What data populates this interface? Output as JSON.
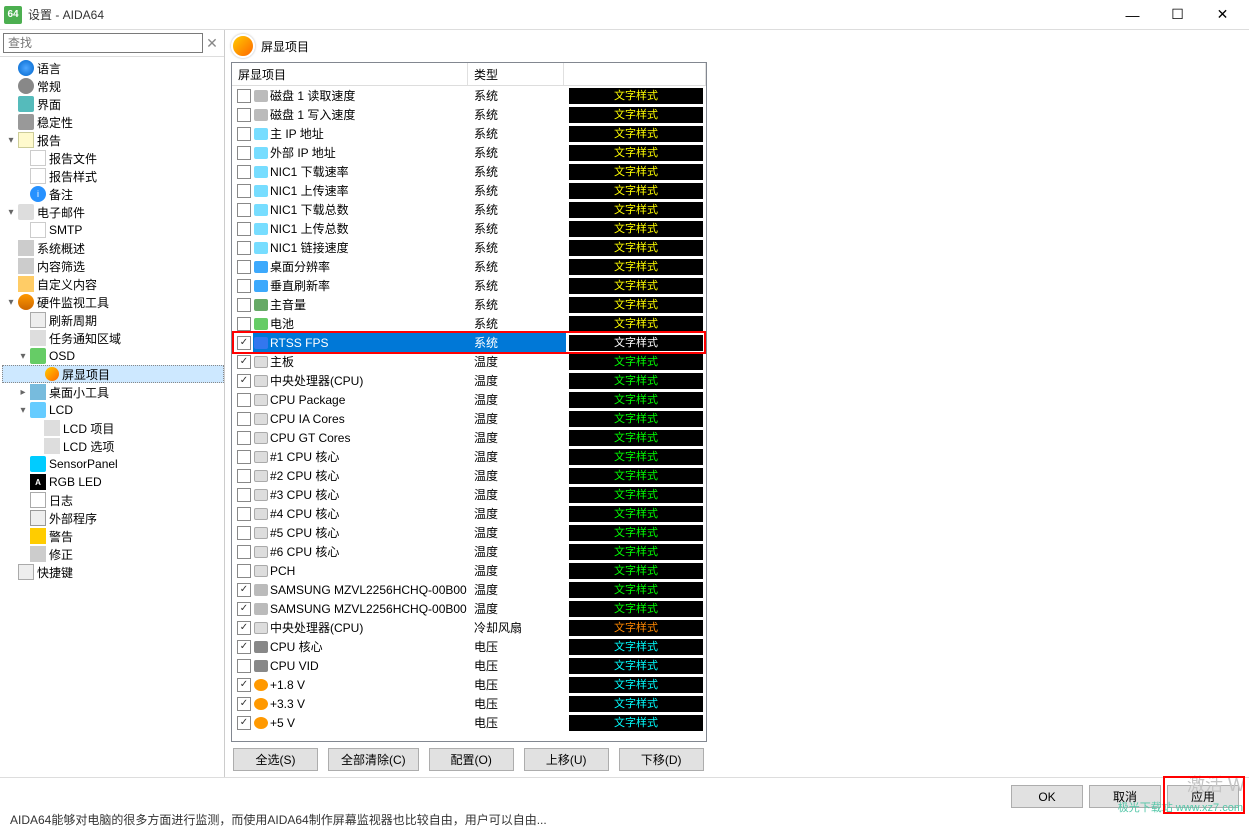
{
  "window": {
    "title": "设置 - AIDA64",
    "app_badge": "64"
  },
  "win_controls": {
    "min": "—",
    "max": "☐",
    "close": "✕"
  },
  "search": {
    "placeholder": "查找",
    "clear": "✕"
  },
  "tree": [
    {
      "label": "语言",
      "icon": "ic-globe",
      "indent": 0
    },
    {
      "label": "常规",
      "icon": "ic-gear",
      "indent": 0
    },
    {
      "label": "界面",
      "icon": "ic-monitor",
      "indent": 0
    },
    {
      "label": "稳定性",
      "icon": "ic-stable",
      "indent": 0
    },
    {
      "label": "报告",
      "icon": "ic-report",
      "indent": 0,
      "toggle": "▾"
    },
    {
      "label": "报告文件",
      "icon": "ic-doc",
      "indent": 1
    },
    {
      "label": "报告样式",
      "icon": "ic-doc",
      "indent": 1
    },
    {
      "label": "备注",
      "icon": "ic-info",
      "indent": 1
    },
    {
      "label": "电子邮件",
      "icon": "ic-mail",
      "indent": 0,
      "toggle": "▾"
    },
    {
      "label": "SMTP",
      "icon": "ic-doc",
      "indent": 1
    },
    {
      "label": "系统概述",
      "icon": "ic-filter",
      "indent": 0
    },
    {
      "label": "内容筛选",
      "icon": "ic-filter",
      "indent": 0
    },
    {
      "label": "自定义内容",
      "icon": "ic-custom",
      "indent": 0
    },
    {
      "label": "硬件监视工具",
      "icon": "ic-hw",
      "indent": 0,
      "toggle": "▾"
    },
    {
      "label": "刷新周期",
      "icon": "ic-timer",
      "indent": 1
    },
    {
      "label": "任务通知区域",
      "icon": "ic-tray",
      "indent": 1
    },
    {
      "label": "OSD",
      "icon": "ic-osd",
      "indent": 1,
      "toggle": "▾"
    },
    {
      "label": "屏显项目",
      "icon": "ic-osditem",
      "indent": 2,
      "selected": true
    },
    {
      "label": "桌面小工具",
      "icon": "ic-gadget",
      "indent": 1,
      "toggle": "▸"
    },
    {
      "label": "LCD",
      "icon": "ic-lcd",
      "indent": 1,
      "toggle": "▾"
    },
    {
      "label": "LCD 项目",
      "icon": "ic-lcdd",
      "indent": 2
    },
    {
      "label": "LCD 选项",
      "icon": "ic-lcdd",
      "indent": 2
    },
    {
      "label": "SensorPanel",
      "icon": "ic-sensor",
      "indent": 1
    },
    {
      "label": "RGB LED",
      "icon": "ic-rgb",
      "indent": 1
    },
    {
      "label": "日志",
      "icon": "ic-log",
      "indent": 1
    },
    {
      "label": "外部程序",
      "icon": "ic-ext",
      "indent": 1
    },
    {
      "label": "警告",
      "icon": "ic-warn",
      "indent": 1
    },
    {
      "label": "修正",
      "icon": "ic-fix",
      "indent": 1
    },
    {
      "label": "快捷键",
      "icon": "ic-key",
      "indent": 0
    }
  ],
  "panel": {
    "title": "屏显项目"
  },
  "table": {
    "head": {
      "c1": "屏显项目",
      "c2": "类型"
    },
    "rows": [
      {
        "chk": false,
        "icon": "dsk",
        "name": "磁盘 1 读取速度",
        "type": "系统",
        "style": "yellow"
      },
      {
        "chk": false,
        "icon": "dsk",
        "name": "磁盘 1 写入速度",
        "type": "系统",
        "style": "yellow"
      },
      {
        "chk": false,
        "icon": "teal",
        "name": "主 IP 地址",
        "type": "系统",
        "style": "yellow"
      },
      {
        "chk": false,
        "icon": "teal",
        "name": "外部 IP 地址",
        "type": "系统",
        "style": "yellow"
      },
      {
        "chk": false,
        "icon": "teal",
        "name": "NIC1 下载速率",
        "type": "系统",
        "style": "yellow"
      },
      {
        "chk": false,
        "icon": "teal",
        "name": "NIC1 上传速率",
        "type": "系统",
        "style": "yellow"
      },
      {
        "chk": false,
        "icon": "teal",
        "name": "NIC1 下载总数",
        "type": "系统",
        "style": "yellow"
      },
      {
        "chk": false,
        "icon": "teal",
        "name": "NIC1 上传总数",
        "type": "系统",
        "style": "yellow"
      },
      {
        "chk": false,
        "icon": "teal",
        "name": "NIC1 链接速度",
        "type": "系统",
        "style": "yellow"
      },
      {
        "chk": false,
        "icon": "blue",
        "name": "桌面分辨率",
        "type": "系统",
        "style": "yellow"
      },
      {
        "chk": false,
        "icon": "blue",
        "name": "垂直刷新率",
        "type": "系统",
        "style": "yellow"
      },
      {
        "chk": false,
        "icon": "vol",
        "name": "主音量",
        "type": "系统",
        "style": "yellow"
      },
      {
        "chk": false,
        "icon": "bat",
        "name": "电池",
        "type": "系统",
        "style": "yellow"
      },
      {
        "chk": true,
        "icon": "fps",
        "name": "RTSS FPS",
        "type": "系统",
        "style": "white",
        "selected": true
      },
      {
        "chk": true,
        "icon": "temp",
        "name": "主板",
        "type": "温度",
        "style": "green"
      },
      {
        "chk": true,
        "icon": "temp",
        "name": "中央处理器(CPU)",
        "type": "温度",
        "style": "green"
      },
      {
        "chk": false,
        "icon": "temp",
        "name": "CPU Package",
        "type": "温度",
        "style": "green"
      },
      {
        "chk": false,
        "icon": "temp",
        "name": "CPU IA Cores",
        "type": "温度",
        "style": "green"
      },
      {
        "chk": false,
        "icon": "temp",
        "name": "CPU GT Cores",
        "type": "温度",
        "style": "green"
      },
      {
        "chk": false,
        "icon": "temp",
        "name": "#1 CPU 核心",
        "type": "温度",
        "style": "green"
      },
      {
        "chk": false,
        "icon": "temp",
        "name": "#2 CPU 核心",
        "type": "温度",
        "style": "green"
      },
      {
        "chk": false,
        "icon": "temp",
        "name": "#3 CPU 核心",
        "type": "温度",
        "style": "green"
      },
      {
        "chk": false,
        "icon": "temp",
        "name": "#4 CPU 核心",
        "type": "温度",
        "style": "green"
      },
      {
        "chk": false,
        "icon": "temp",
        "name": "#5 CPU 核心",
        "type": "温度",
        "style": "green"
      },
      {
        "chk": false,
        "icon": "temp",
        "name": "#6 CPU 核心",
        "type": "温度",
        "style": "green"
      },
      {
        "chk": false,
        "icon": "temp",
        "name": "PCH",
        "type": "温度",
        "style": "green"
      },
      {
        "chk": true,
        "icon": "dsk",
        "name": "SAMSUNG MZVL2256HCHQ-00B00",
        "type": "温度",
        "style": "green"
      },
      {
        "chk": true,
        "icon": "dsk",
        "name": "SAMSUNG MZVL2256HCHQ-00B00 ...",
        "type": "温度",
        "style": "green"
      },
      {
        "chk": true,
        "icon": "temp",
        "name": "中央处理器(CPU)",
        "type": "冷却风扇",
        "style": "orange"
      },
      {
        "chk": true,
        "icon": "chip",
        "name": "CPU 核心",
        "type": "电压",
        "style": "cyan"
      },
      {
        "chk": false,
        "icon": "chip",
        "name": "CPU VID",
        "type": "电压",
        "style": "cyan"
      },
      {
        "chk": true,
        "icon": "volt",
        "name": "+1.8 V",
        "type": "电压",
        "style": "cyan"
      },
      {
        "chk": true,
        "icon": "volt",
        "name": "+3.3 V",
        "type": "电压",
        "style": "cyan"
      },
      {
        "chk": true,
        "icon": "volt",
        "name": "+5 V",
        "type": "电压",
        "style": "cyan"
      }
    ],
    "style_text": "文字样式"
  },
  "buttons": {
    "select_all": "全选(S)",
    "clear_all": "全部清除(C)",
    "config": "配置(O)",
    "move_up": "上移(U)",
    "move_down": "下移(D)"
  },
  "dialog": {
    "ok": "OK",
    "cancel": "取消",
    "apply": "应用"
  },
  "watermark": "激活 W",
  "watermark2": "极光下载站\nwww.xz7.com",
  "caption": "AIDA64能够对电脑的很多方面进行监测，而使用AIDA64制作屏幕监视器也比较自由，用户可以自由..."
}
